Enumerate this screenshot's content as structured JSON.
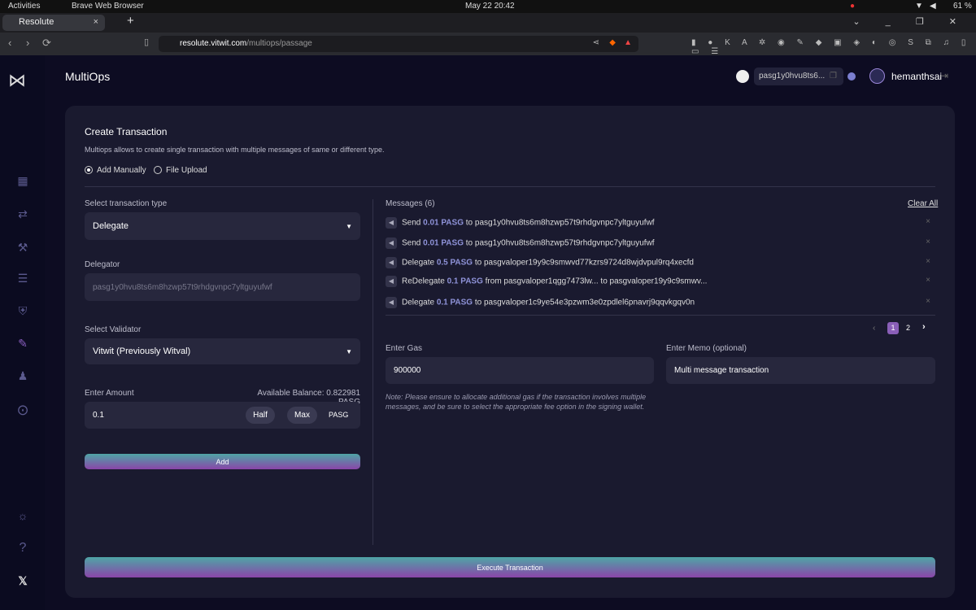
{
  "os": {
    "activities": "Activities",
    "app": "Brave Web Browser",
    "clock": "May 22  20:42",
    "battery": "61 %"
  },
  "browser": {
    "tab_title": "Resolute",
    "url_host": "resolute.vitwit.com",
    "url_path": "/multiops/passage"
  },
  "sidebar": {
    "items": [
      {
        "icon": "dashboard-icon"
      },
      {
        "icon": "transfer-icon"
      },
      {
        "icon": "gavel-icon"
      },
      {
        "icon": "staking-icon"
      },
      {
        "icon": "shield-icon"
      },
      {
        "icon": "multiops-icon"
      },
      {
        "icon": "user-check-icon"
      },
      {
        "icon": "more-icon"
      }
    ],
    "bottom": [
      {
        "icon": "lightbulb-icon"
      },
      {
        "icon": "help-icon"
      },
      {
        "icon": "x-logo-icon"
      }
    ]
  },
  "header": {
    "title": "MultiOps",
    "address": "pasg1y0hvu8ts6...",
    "username": "hemanthsai"
  },
  "form": {
    "title": "Create Transaction",
    "description": "Multiops allows to create single transaction with multiple messages of same or different type.",
    "mode_options": [
      {
        "label": "Add Manually",
        "selected": true
      },
      {
        "label": "File Upload",
        "selected": false
      }
    ],
    "tx_type_label": "Select transaction type",
    "tx_type_value": "Delegate",
    "delegator_label": "Delegator",
    "delegator_value": "pasg1y0hvu8ts6m8hzwp57t9rhdgvnpc7yltguyufwf",
    "validator_label": "Select Validator",
    "validator_value": "Vitwit (Previously Witval)",
    "amount_label": "Enter Amount",
    "balance": "Available Balance: 0.822981 PASG",
    "amount_value": "0.1",
    "half_label": "Half",
    "max_label": "Max",
    "denom": "PASG",
    "add_label": "Add"
  },
  "messages": {
    "header": "Messages (6)",
    "clear_all": "Clear All",
    "items": [
      {
        "type": "Send",
        "amount": "0.01 PASG",
        "rest": "to pasg1y0hvu8ts6m8hzwp57t9rhdgvnpc7yltguyufwf"
      },
      {
        "type": "Send",
        "amount": "0.01 PASG",
        "rest": "to pasg1y0hvu8ts6m8hzwp57t9rhdgvnpc7yltguyufwf"
      },
      {
        "type": "Delegate",
        "amount": "0.5 PASG",
        "rest": "to pasgvaloper19y9c9smwvd77kzrs9724d8wjdvpul9rq4xecfd"
      },
      {
        "type": "ReDelegate",
        "amount": "0.1 PASG",
        "rest": "from pasgvaloper1qgg7473lw... to pasgvaloper19y9c9smwv..."
      },
      {
        "type": "Delegate",
        "amount": "0.1 PASG",
        "rest": "to pasgvaloper1c9ye54e3pzwm3e0zpdlel6pnavrj9qqvkgqv0n"
      }
    ],
    "pages": [
      "1",
      "2"
    ],
    "current_page": "1",
    "gas_label": "Enter Gas",
    "gas_value": "900000",
    "memo_label": "Enter Memo (optional)",
    "memo_value": "Multi message transaction",
    "note": "Note: Please ensure to allocate additional gas if the transaction involves multiple messages, and be sure to select the appropriate fee option in the signing wallet."
  },
  "execute_label": "Execute Transaction",
  "colors": {
    "background": "#0d0c22",
    "card": "#1a1a2f",
    "accent_start": "#4fa5a6",
    "accent_end": "#8a45a9",
    "amount": "#8f93d9"
  }
}
